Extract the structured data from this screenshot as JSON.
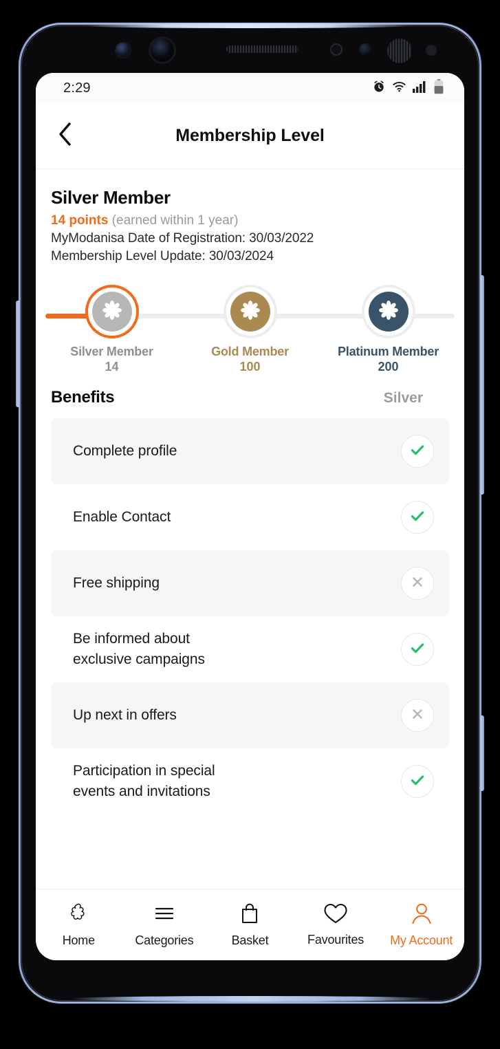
{
  "device": {
    "frame_color": "#9fb4dd",
    "body_color": "#0a0a0c"
  },
  "status_bar": {
    "time": "2:29",
    "icons": [
      "alarm-icon",
      "wifi-icon",
      "cellular-signal-icon",
      "battery-icon"
    ]
  },
  "header": {
    "back_icon": "chevron-left-icon",
    "title": "Membership Level"
  },
  "member": {
    "level_name": "Silver Member",
    "points_value": "14 points",
    "points_note": " (earned within 1 year)",
    "registration_line": "MyModanisa Date of Registration: 30/03/2022",
    "update_line": "Membership Level Update: 30/03/2024",
    "points_color": "#ef6c1a"
  },
  "levels": {
    "progress_percent": 14,
    "items": [
      {
        "label": "Silver Member",
        "points": "14",
        "color": "#b6b6b6",
        "text_color": "#8f8f8f",
        "active": true
      },
      {
        "label": "Gold Member",
        "points": "100",
        "color": "#ab8a51",
        "text_color": "#ab8a51",
        "active": false
      },
      {
        "label": "Platinum Member",
        "points": "200",
        "color": "#395469",
        "text_color": "#395469",
        "active": false
      }
    ]
  },
  "benefits": {
    "title": "Benefits",
    "column_label": "Silver",
    "check_color": "#24c072",
    "cross_color": "#b9b9b9",
    "rows": [
      {
        "label": "Complete profile",
        "status": "check",
        "shaded": true
      },
      {
        "label": "Enable Contact",
        "status": "check",
        "shaded": false
      },
      {
        "label": "Free shipping",
        "status": "cross",
        "shaded": true
      },
      {
        "label": "Be informed about\nexclusive campaigns",
        "status": "check",
        "shaded": false
      },
      {
        "label": "Up next in offers",
        "status": "cross",
        "shaded": true
      },
      {
        "label": "Participation in special\nevents and invitations",
        "status": "check",
        "shaded": false
      }
    ]
  },
  "bottom_nav": {
    "active_color": "#ef6c1a",
    "items": [
      {
        "label": "Home",
        "icon": "flower-home-icon",
        "active": false
      },
      {
        "label": "Categories",
        "icon": "hamburger-menu-icon",
        "active": false
      },
      {
        "label": "Basket",
        "icon": "shopping-bag-icon",
        "active": false
      },
      {
        "label": "Favourites",
        "icon": "heart-icon",
        "active": false
      },
      {
        "label": "My Account",
        "icon": "person-icon",
        "active": true
      }
    ]
  }
}
